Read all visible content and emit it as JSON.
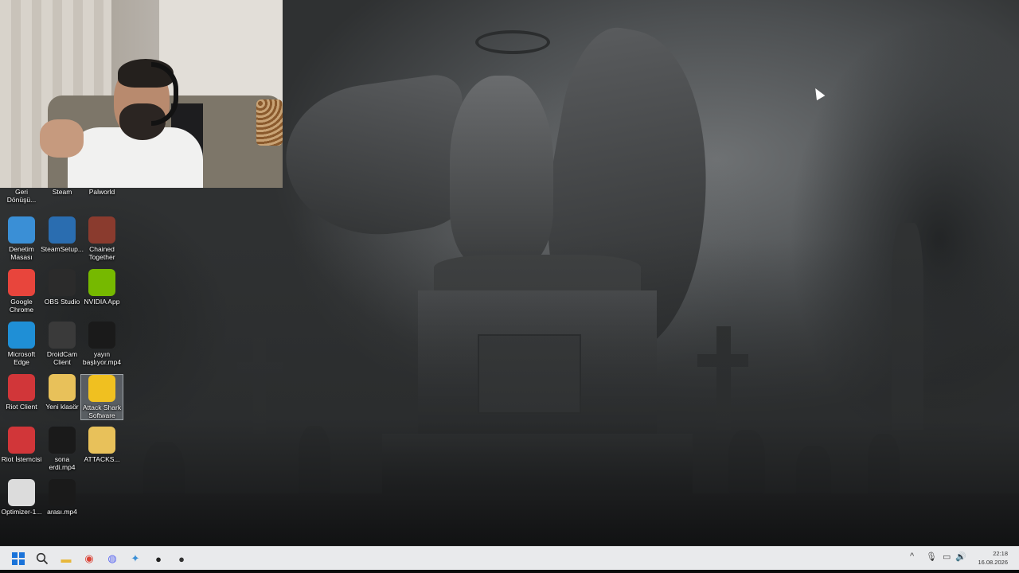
{
  "desktop": {
    "icons": [
      {
        "label": "Geri\nDönüşü...",
        "icon": "recycle-bin-icon",
        "color": "#9aa7b4"
      },
      {
        "label": "Steam",
        "icon": "steam-icon",
        "color": "#1b2838"
      },
      {
        "label": "Palworld",
        "icon": "palworld-icon",
        "color": "#4a7fb0"
      },
      {
        "label": "Denetim\nMasası",
        "icon": "control-panel-icon",
        "color": "#3a8fd6"
      },
      {
        "label": "SteamSetup...",
        "icon": "steam-setup-icon",
        "color": "#2a6db0"
      },
      {
        "label": "Chained\nTogether",
        "icon": "chained-together-icon",
        "color": "#8a3b2e"
      },
      {
        "label": "Google\nChrome",
        "icon": "chrome-icon",
        "color": "#e8453c"
      },
      {
        "label": "OBS Studio",
        "icon": "obs-icon",
        "color": "#2b2b2b"
      },
      {
        "label": "NVIDIA App",
        "icon": "nvidia-icon",
        "color": "#76b900"
      },
      {
        "label": "Microsoft\nEdge",
        "icon": "edge-icon",
        "color": "#1f8fd6"
      },
      {
        "label": "DroidCam\nClient",
        "icon": "droidcam-icon",
        "color": "#3a3a3a"
      },
      {
        "label": "yayın\nbaşlıyor.mp4",
        "icon": "video-file-icon",
        "color": "#1a1a1a"
      },
      {
        "label": "Riot Client",
        "icon": "riot-client-icon",
        "color": "#d13639"
      },
      {
        "label": "Yeni klasör",
        "icon": "folder-icon",
        "color": "#e8c15a"
      },
      {
        "label": "Attack Shark\nSoftware",
        "icon": "attack-shark-icon",
        "color": "#f0c020"
      },
      {
        "label": "Riot İstemcisi",
        "icon": "riot-client-icon",
        "color": "#d13639"
      },
      {
        "label": "sona\nerdi.mp4",
        "icon": "video-file-icon",
        "color": "#1a1a1a"
      },
      {
        "label": "ATTACKS...",
        "icon": "folder-icon",
        "color": "#e8c15a"
      },
      {
        "label": "Optimizer-1...",
        "icon": "checkmark-icon",
        "color": "#dcdcdc"
      },
      {
        "label": "arası.mp4",
        "icon": "video-file-icon",
        "color": "#1a1a1a"
      }
    ]
  },
  "taskbar": {
    "start_icon": "windows-start-icon",
    "search_icon": "search-icon",
    "pinned": [
      {
        "name": "file-explorer-icon",
        "glyph": "▬",
        "color": "#e7b73b"
      },
      {
        "name": "chrome-taskbar-icon",
        "glyph": "◉",
        "color": "#db4437"
      },
      {
        "name": "discord-taskbar-icon",
        "glyph": "◍",
        "color": "#5865f2"
      },
      {
        "name": "app-taskbar-icon",
        "glyph": "✦",
        "color": "#3a8fd6"
      },
      {
        "name": "obs-taskbar-icon",
        "glyph": "●",
        "color": "#222222"
      },
      {
        "name": "riot-taskbar-icon",
        "glyph": "●",
        "color": "#333333"
      }
    ],
    "tray": {
      "chevron": "^",
      "mic": "🎙",
      "network": "▭",
      "volume": "🔊"
    },
    "time": "22:18",
    "date": "16.08.2026"
  }
}
